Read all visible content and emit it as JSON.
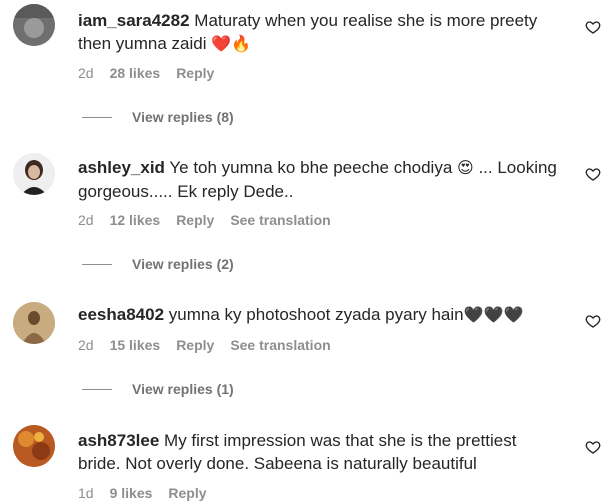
{
  "comments": [
    {
      "username": "iam_sara4282",
      "text": "Maturaty when you realise she is more preety then yumna zaidi",
      "emoji": "❤️🔥",
      "time": "2d",
      "likes": "28 likes",
      "reply": "Reply",
      "translation": "",
      "view_replies": "View replies (8)"
    },
    {
      "username": "ashley_xid",
      "text": "Ye toh yumna ko bhe peeche chodiya",
      "emoji_mid": "😍",
      "text2": " ... Looking gorgeous..... Ek reply Dede..",
      "time": "2d",
      "likes": "12 likes",
      "reply": "Reply",
      "translation": "See translation",
      "view_replies": "View replies (2)"
    },
    {
      "username": "eesha8402",
      "text": "yumna ky photoshoot zyada pyary hain",
      "emoji": "🖤🖤🖤",
      "time": "2d",
      "likes": "15 likes",
      "reply": "Reply",
      "translation": "See translation",
      "view_replies": "View replies (1)"
    },
    {
      "username": "ash873lee",
      "text": "My first impression was that she is the prettiest bride. Not overly done. Sabeena is naturally beautiful",
      "time": "1d",
      "likes": "9 likes",
      "reply": "Reply",
      "translation": "",
      "view_replies": ""
    }
  ]
}
